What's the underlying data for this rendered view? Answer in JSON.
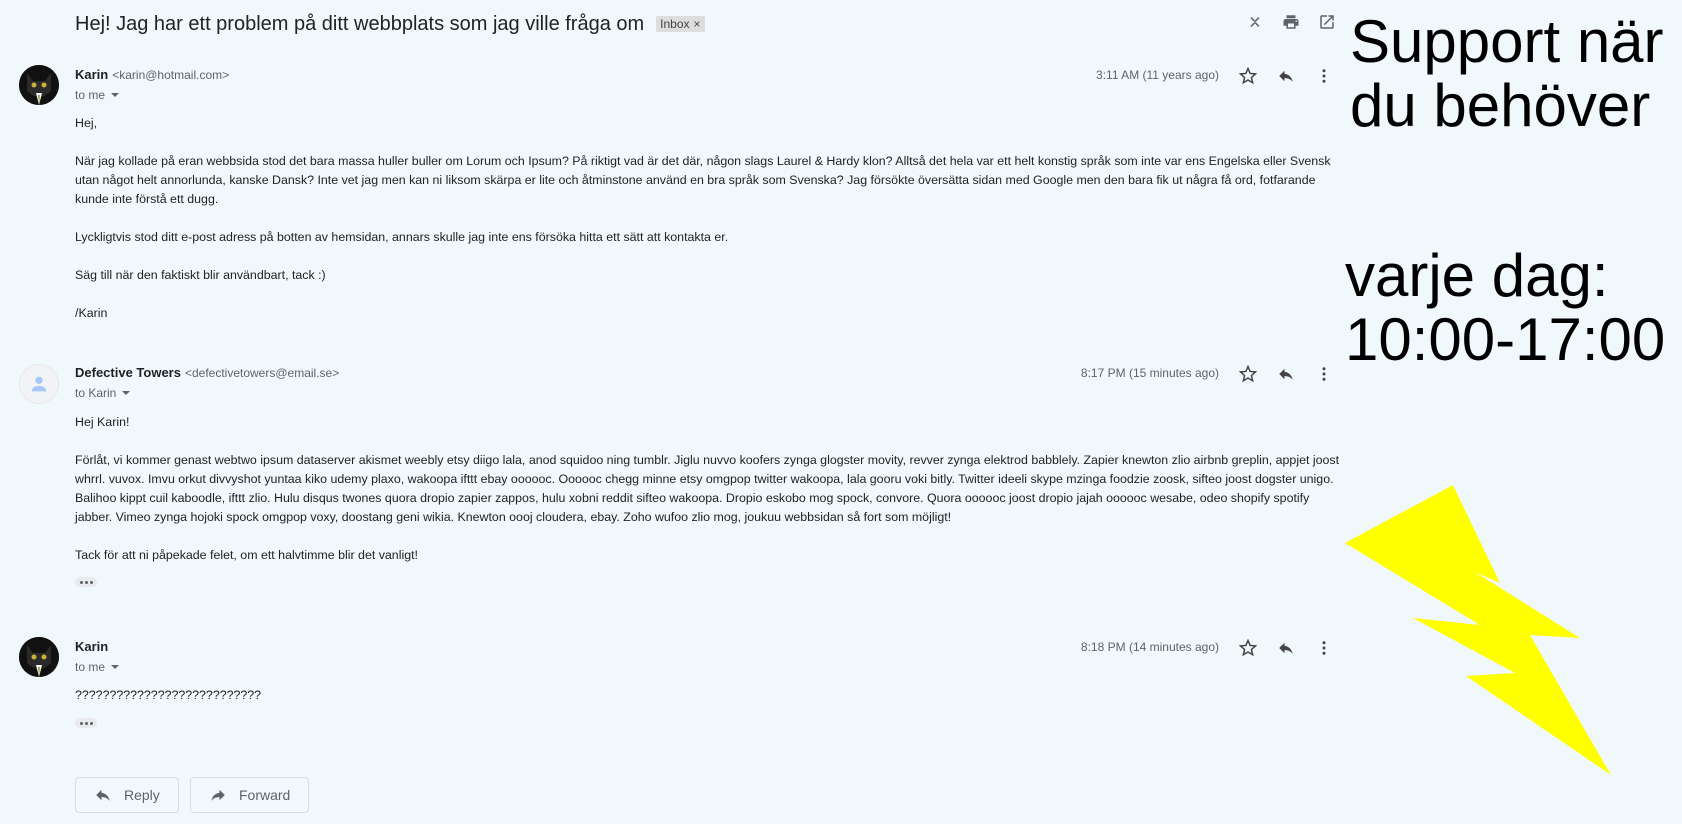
{
  "email": {
    "subject": "Hej! Jag har ett problem på ditt webbplats som jag ville fråga om",
    "label": "Inbox",
    "label_remove": "×"
  },
  "messages": [
    {
      "sender_name": "Karin",
      "sender_email": "<karin@hotmail.com>",
      "to": "to me",
      "time": "3:11 AM (11 years ago)",
      "avatar": "cat-avatar",
      "paragraphs": [
        "Hej,",
        "När jag kollade på eran webbsida stod det bara massa huller buller om Lorum och Ipsum? På riktigt vad är det där, någon slags Laurel & Hardy klon? Alltså det hela var ett helt konstig språk som inte var ens Engelska eller Svensk utan något helt annorlunda, kanske Dansk? Inte vet jag men kan ni liksom skärpa er lite och åtminstone använd en bra språk som Svenska? Jag försökte översätta sidan med Google men den bara fik ut några få ord, fotfarande kunde inte förstå ett dugg.",
        "Lyckligtvis stod ditt e-post adress på botten av hemsidan, annars skulle jag inte ens försöka hitta ett sätt att kontakta er.",
        "Säg till när den faktiskt blir användbart, tack :)",
        "/Karin"
      ]
    },
    {
      "sender_name": "Defective Towers",
      "sender_email": "<defectivetowers@email.se>",
      "to": "to Karin",
      "time": "8:17 PM (15 minutes ago)",
      "avatar": "default-avatar",
      "paragraphs": [
        "Hej Karin!",
        "Förlåt, vi kommer genast webtwo ipsum dataserver akismet weebly etsy diigo lala, anod squidoo ning tumblr. Jiglu nuvvo koofers zynga glogster movity, revver zynga elektrod babblely. Zapier knewton zlio airbnb greplin, appjet joost whrrl. vuvox.  Imvu orkut divvyshot yuntaa kiko udemy plaxo, wakoopa ifttt ebay oooooc.  Oooooc chegg minne etsy omgpop twitter wakoopa, lala gooru voki bitly. Twitter ideeli skype mzinga foodzie zoosk, sifteo joost dogster unigo. Balihoo kippt cuil kaboodle, ifttt zlio. Hulu disqus twones quora dropio zapier zappos, hulu xobni reddit sifteo wakoopa. Dropio eskobo mog spock, convore. Quora oooooc joost dropio jajah oooooc wesabe, odeo shopify spotify jabber. Vimeo zynga hojoki spock omgpop voxy, doostang geni wikia. Knewton oooj cloudera, ebay. Zoho wufoo zlio mog, joukuu webbsidan så fort som möjligt!",
        "Tack för att ni påpekade felet, om ett halvtimme blir det vanligt!"
      ]
    },
    {
      "sender_name": "Karin",
      "sender_email": "",
      "to": "to me",
      "time": "8:18 PM (14 minutes ago)",
      "avatar": "cat-avatar",
      "paragraphs": [
        "???????????????????????????"
      ]
    }
  ],
  "actions": {
    "reply": "Reply",
    "forward": "Forward"
  },
  "promo": {
    "line1": "Support när",
    "line2": "du behöver",
    "line3": "varje dag:",
    "line4": "10:00-17:00",
    "bolt_color": "#ffff00"
  },
  "colors": {
    "background": "#f1f8fc"
  }
}
